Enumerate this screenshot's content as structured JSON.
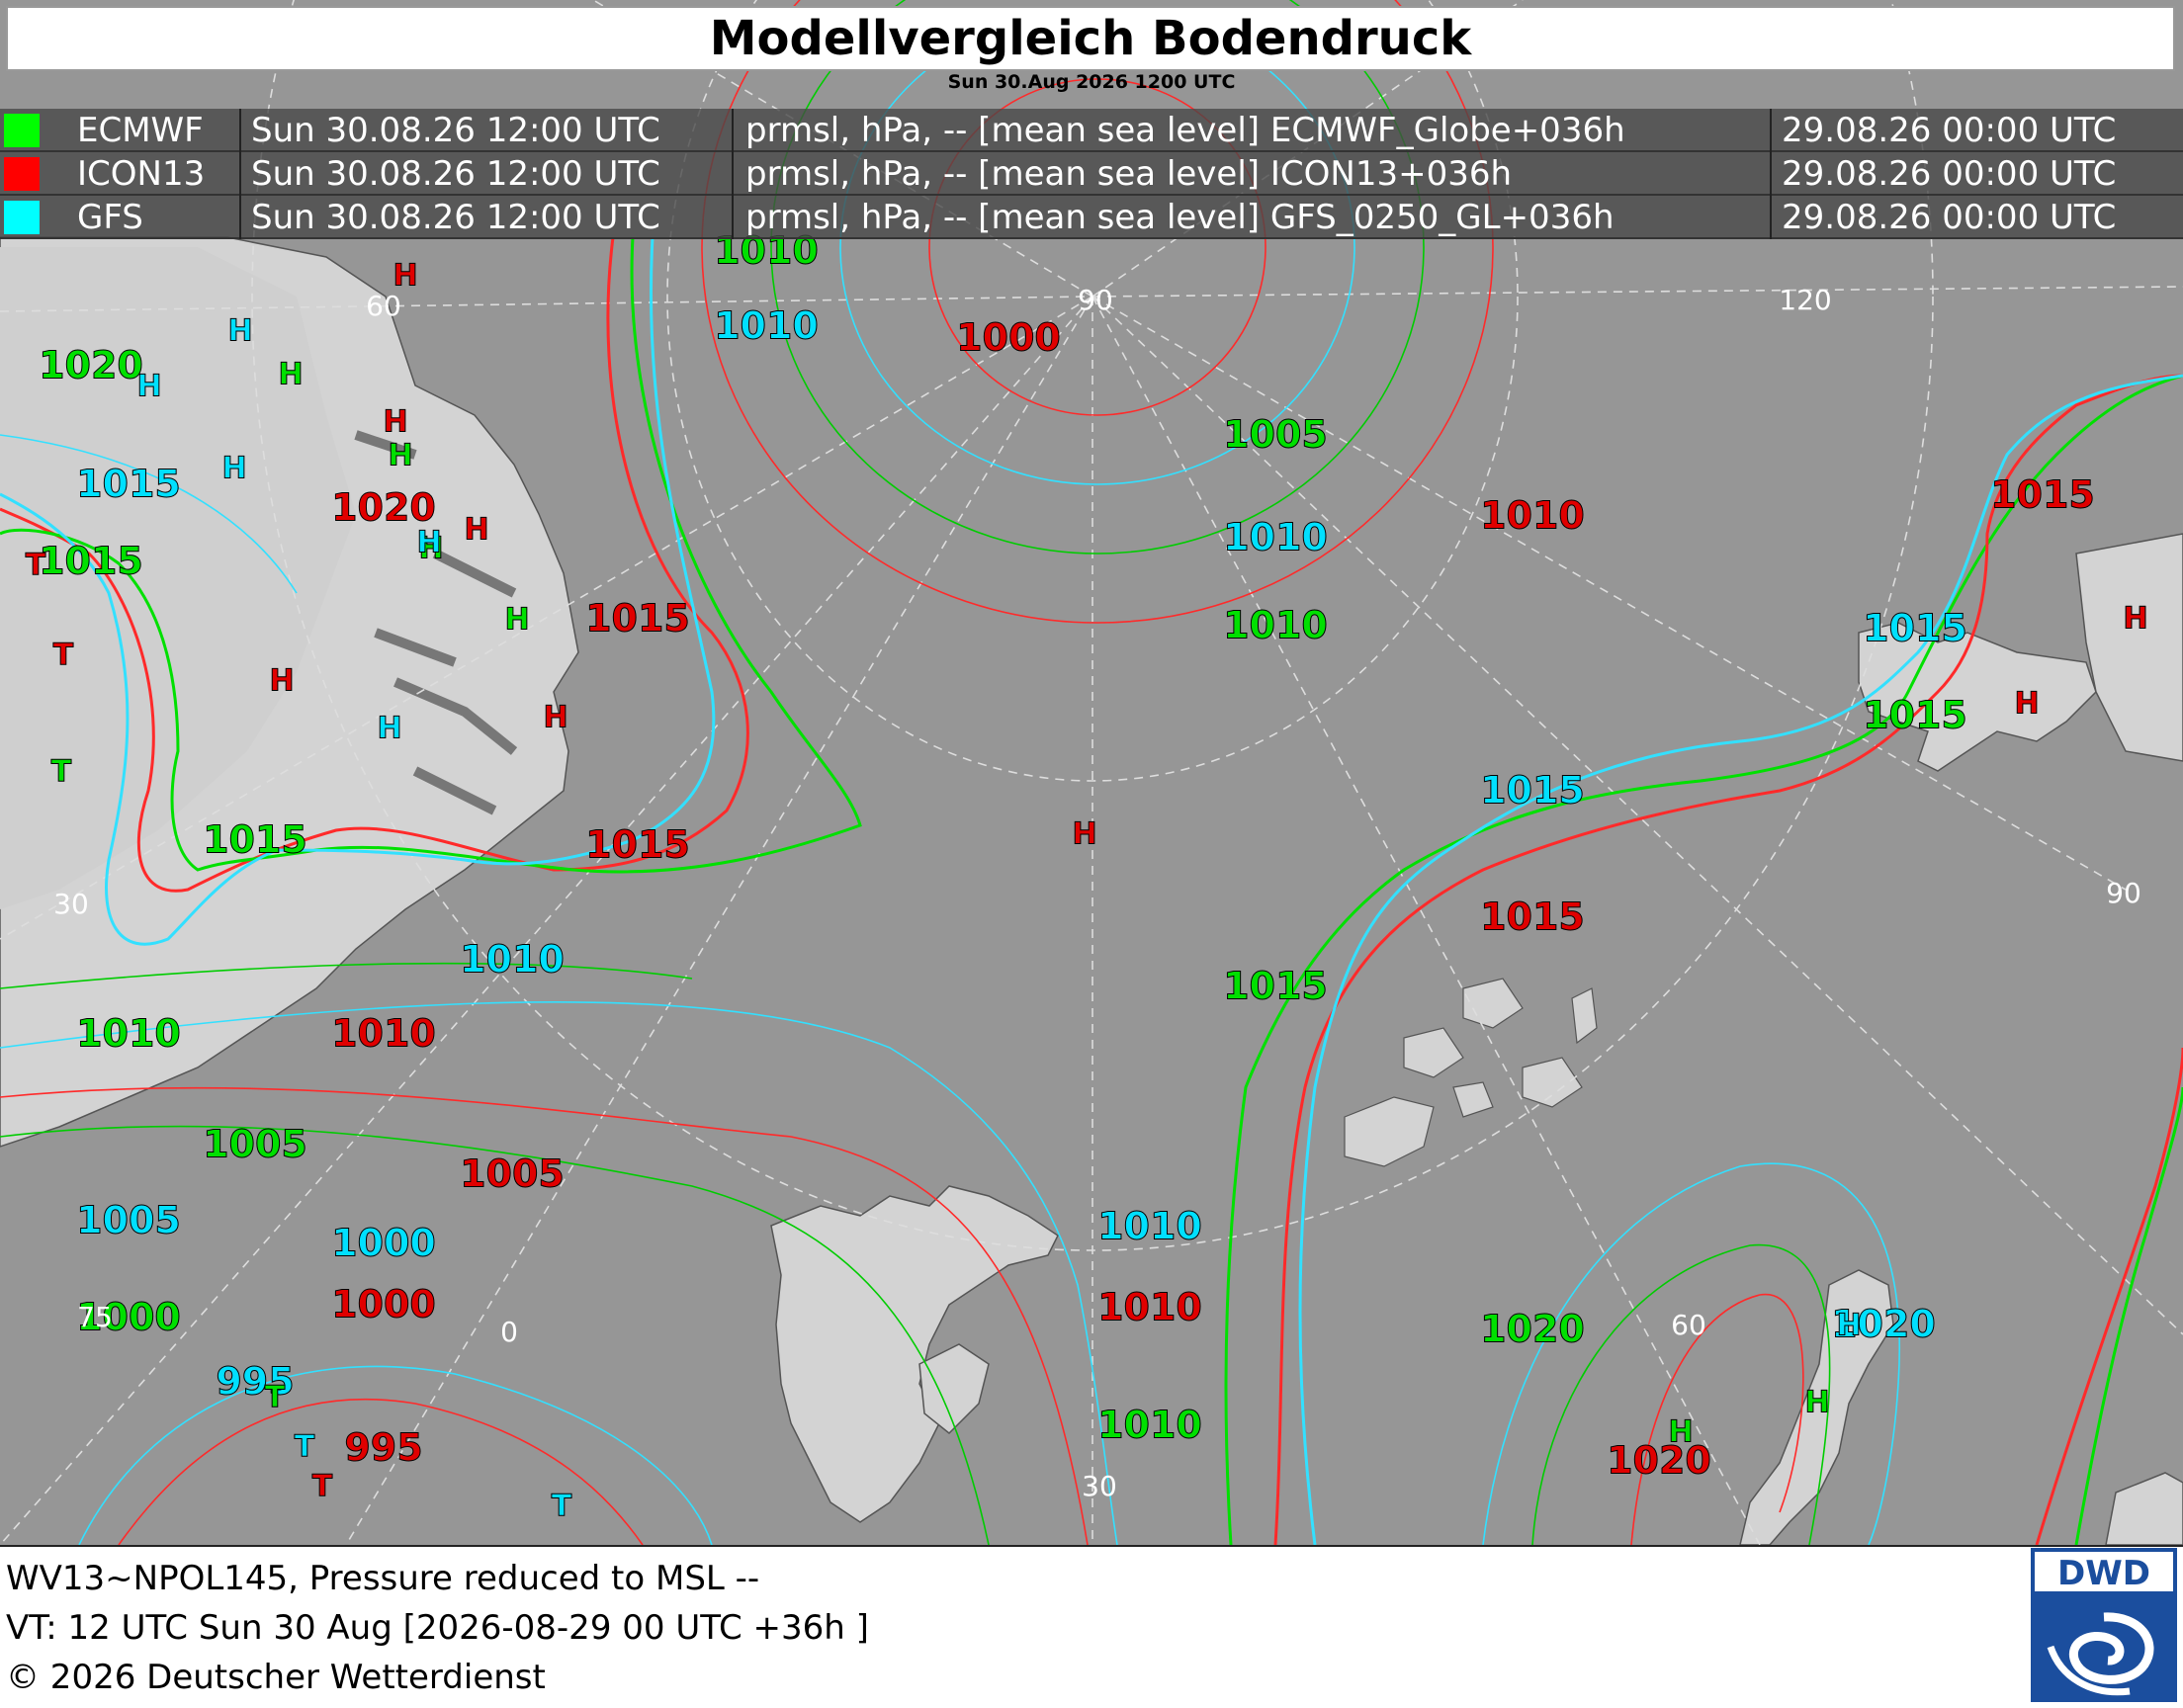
{
  "header": {
    "title": "Modellvergleich Bodendruck",
    "subtitle": "Sun 30.Aug 2026 1200 UTC"
  },
  "legend": {
    "rows": [
      {
        "model": "ECMWF",
        "valid": "Sun 30.08.26 12:00 UTC",
        "field": "prmsl, hPa, -- [mean sea level] ECMWF_Globe+036h",
        "run": "29.08.26 00:00 UTC",
        "color": "#00ff00"
      },
      {
        "model": "ICON13",
        "valid": "Sun 30.08.26 12:00 UTC",
        "field": "prmsl, hPa, -- [mean sea level] ICON13+036h",
        "run": "29.08.26 00:00 UTC",
        "color": "#ff0000"
      },
      {
        "model": "GFS",
        "valid": "Sun 30.08.26 12:00 UTC",
        "field": "prmsl, hPa, -- [mean sea level] GFS_0250_GL+036h",
        "run": "29.08.26 00:00 UTC",
        "color": "#00ffff"
      }
    ]
  },
  "colors": {
    "ecmwf": "#00e000",
    "icon": "#e00000",
    "gfs": "#00e0ff"
  },
  "map_labels": {
    "isobar_values": [
      {
        "text": "1020",
        "model": "ecmwf"
      },
      {
        "text": "1015",
        "model": "gfs"
      },
      {
        "text": "1015",
        "model": "ecmwf"
      },
      {
        "text": "1020",
        "model": "icon"
      },
      {
        "text": "1015",
        "model": "icon"
      },
      {
        "text": "1015",
        "model": "ecmwf"
      },
      {
        "text": "1015",
        "model": "icon"
      },
      {
        "text": "1010",
        "model": "gfs"
      },
      {
        "text": "1010",
        "model": "ecmwf"
      },
      {
        "text": "1010",
        "model": "icon"
      },
      {
        "text": "1005",
        "model": "ecmwf"
      },
      {
        "text": "1005",
        "model": "icon"
      },
      {
        "text": "1005",
        "model": "gfs"
      },
      {
        "text": "1000",
        "model": "gfs"
      },
      {
        "text": "1000",
        "model": "icon"
      },
      {
        "text": "1000",
        "model": "ecmwf"
      },
      {
        "text": "995",
        "model": "gfs"
      },
      {
        "text": "995",
        "model": "icon"
      },
      {
        "text": "1010",
        "model": "ecmwf"
      },
      {
        "text": "1010",
        "model": "gfs"
      },
      {
        "text": "1000",
        "model": "icon"
      },
      {
        "text": "1005",
        "model": "ecmwf"
      },
      {
        "text": "1010",
        "model": "gfs"
      },
      {
        "text": "1010",
        "model": "ecmwf"
      },
      {
        "text": "1010",
        "model": "icon"
      },
      {
        "text": "1015",
        "model": "gfs"
      },
      {
        "text": "1015",
        "model": "icon"
      },
      {
        "text": "1015",
        "model": "ecmwf"
      },
      {
        "text": "1010",
        "model": "gfs"
      },
      {
        "text": "1010",
        "model": "icon"
      },
      {
        "text": "1010",
        "model": "ecmwf"
      },
      {
        "text": "1015",
        "model": "icon"
      },
      {
        "text": "1015",
        "model": "gfs"
      },
      {
        "text": "1015",
        "model": "ecmwf"
      },
      {
        "text": "1020",
        "model": "ecmwf"
      },
      {
        "text": "1020",
        "model": "gfs"
      },
      {
        "text": "1020",
        "model": "icon"
      }
    ],
    "pressure_centers": [
      {
        "text": "H",
        "model": "icon"
      },
      {
        "text": "H",
        "model": "gfs"
      },
      {
        "text": "H",
        "model": "ecmwf"
      },
      {
        "text": "H",
        "model": "gfs"
      },
      {
        "text": "H",
        "model": "icon"
      },
      {
        "text": "H",
        "model": "ecmwf"
      },
      {
        "text": "H",
        "model": "gfs"
      },
      {
        "text": "H",
        "model": "icon"
      },
      {
        "text": "H",
        "model": "ecmwf"
      },
      {
        "text": "H",
        "model": "gfs"
      },
      {
        "text": "H",
        "model": "ecmwf"
      },
      {
        "text": "H",
        "model": "icon"
      },
      {
        "text": "H",
        "model": "icon"
      },
      {
        "text": "H",
        "model": "gfs"
      },
      {
        "text": "H",
        "model": "icon"
      },
      {
        "text": "H",
        "model": "gfs"
      },
      {
        "text": "H",
        "model": "icon"
      },
      {
        "text": "H",
        "model": "icon"
      },
      {
        "text": "H",
        "model": "ecmwf"
      },
      {
        "text": "H",
        "model": "ecmwf"
      },
      {
        "text": "H",
        "model": "gfs"
      },
      {
        "text": "T",
        "model": "icon"
      },
      {
        "text": "T",
        "model": "icon"
      },
      {
        "text": "T",
        "model": "ecmwf"
      },
      {
        "text": "T",
        "model": "ecmwf"
      },
      {
        "text": "T",
        "model": "gfs"
      },
      {
        "text": "T",
        "model": "icon"
      },
      {
        "text": "T",
        "model": "gfs"
      }
    ],
    "graticule": [
      "90",
      "60",
      "120",
      "30",
      "90",
      "0",
      "30",
      "60",
      "75"
    ]
  },
  "footer": {
    "line1": "WV13~NPOL145, Pressure reduced to MSL --",
    "line2": "VT: 12 UTC Sun  30 Aug [2026-08-29 00 UTC +36h ]",
    "line3": "© 2026 Deutscher Wetterdienst"
  },
  "logo": {
    "text": "DWD"
  }
}
